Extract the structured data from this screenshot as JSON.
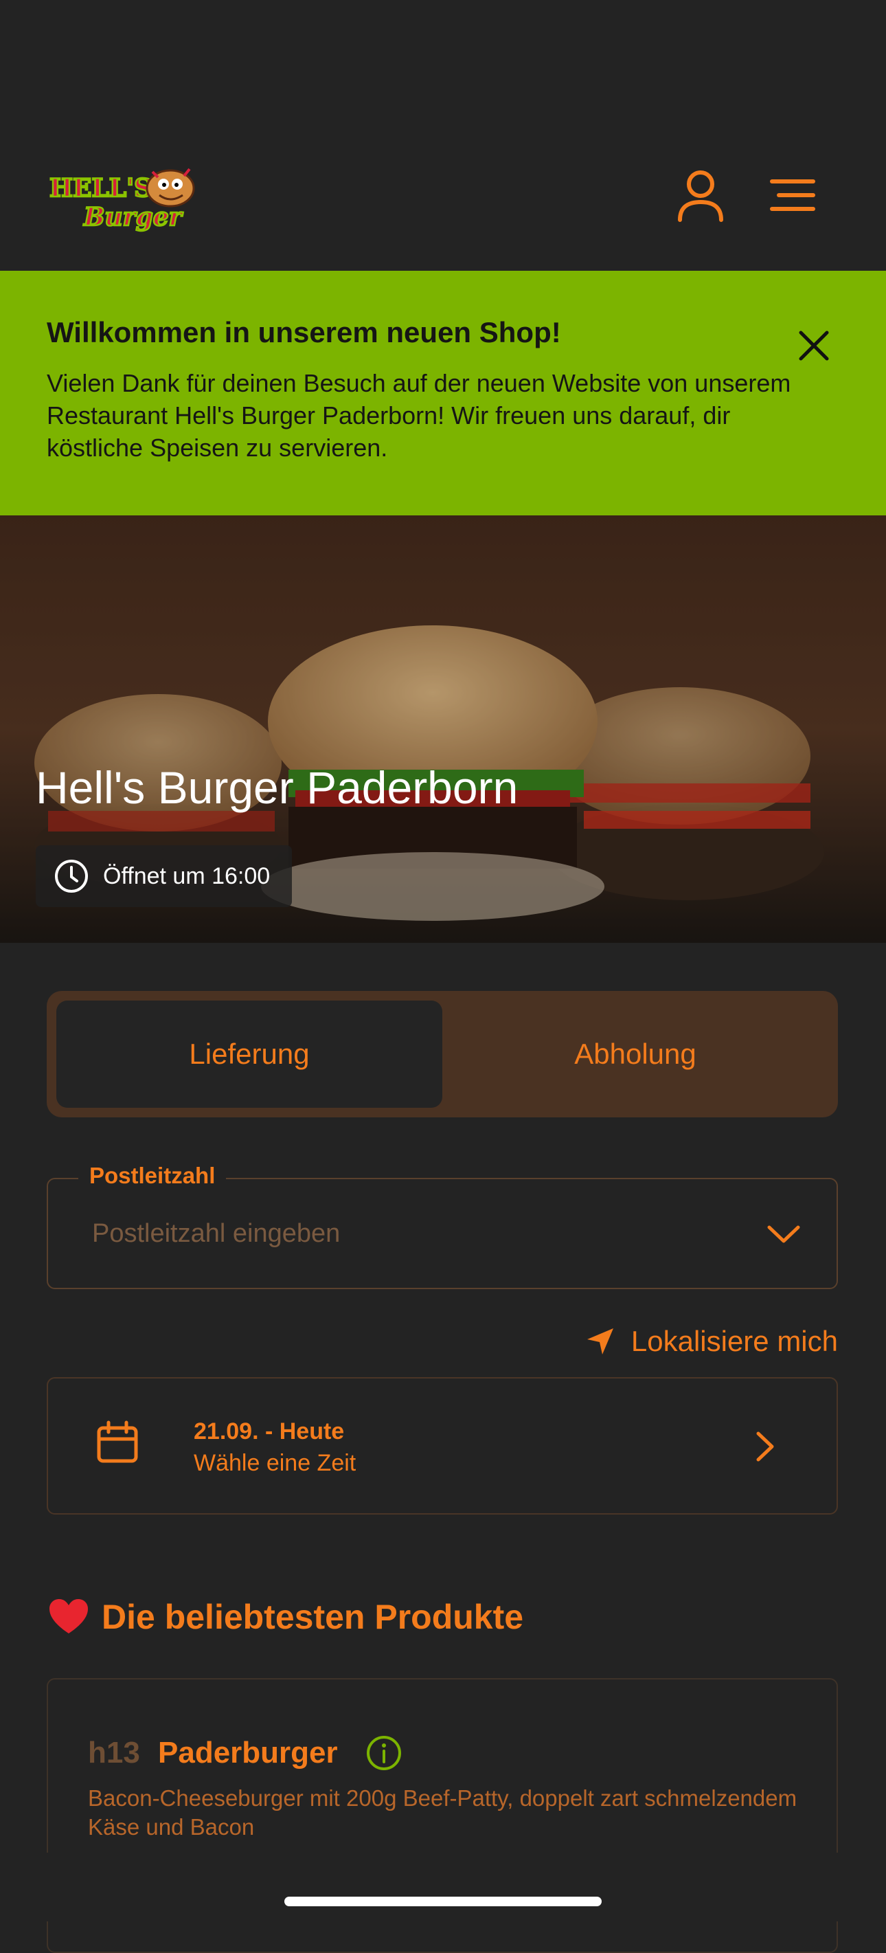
{
  "header": {
    "logo_line1": "HELL'S",
    "logo_line2": "Burger",
    "account_icon": "user-icon",
    "menu_icon": "hamburger-menu-icon"
  },
  "banner": {
    "title": "Willkommen in unserem neuen Shop!",
    "text": "Vielen Dank für deinen Besuch auf der neuen Website von unserem Restaurant Hell's Burger Paderborn! Wir freuen uns darauf, dir köstliche Speisen zu servieren.",
    "close_icon": "close-icon"
  },
  "hero": {
    "title": "Hell's Burger Paderborn",
    "status": "Öffnet um 16:00",
    "status_icon": "clock-icon"
  },
  "order_mode": {
    "options": [
      "Lieferung",
      "Abholung"
    ],
    "selected": "Lieferung"
  },
  "postcode": {
    "label": "Postleitzahl",
    "placeholder": "Postleitzahl eingeben",
    "icon": "chevron-down-icon"
  },
  "locate": {
    "label": "Lokalisiere mich",
    "icon": "location-arrow-icon"
  },
  "date_picker": {
    "date": "21.09. - Heute",
    "hint": "Wähle eine Zeit",
    "icon": "calendar-icon",
    "arrow_icon": "chevron-right-icon"
  },
  "popular": {
    "title": "Die beliebtesten Produkte",
    "icon": "heart-icon",
    "products": [
      {
        "code": "h13",
        "name": "Paderburger",
        "description": "Bacon-Cheeseburger mit 200g Beef-Patty, doppelt zart schmelzendem Käse und Bacon",
        "info_icon": "info-icon"
      }
    ]
  },
  "colors": {
    "background": "#232323",
    "accent": "#f47c1c",
    "banner": "#7cb400",
    "segment_bg": "#4a3222"
  }
}
